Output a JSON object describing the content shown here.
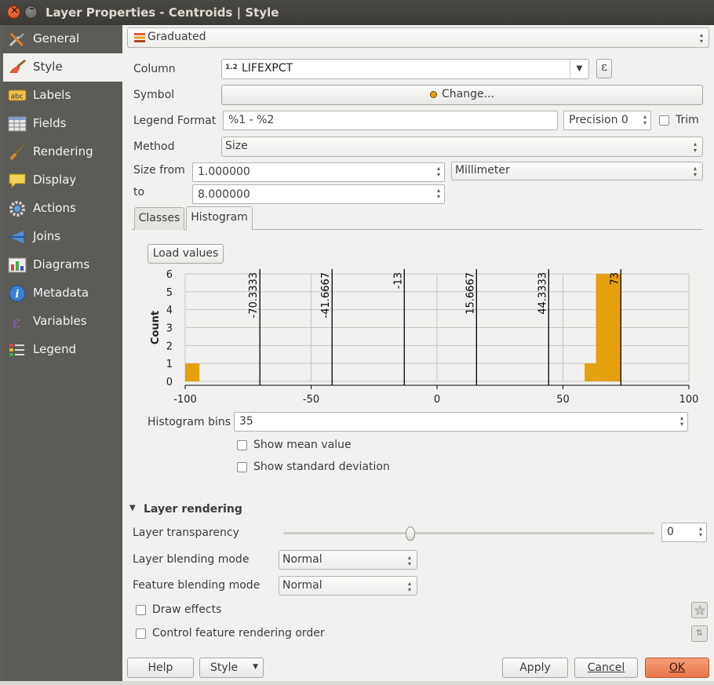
{
  "window": {
    "title": "Layer Properties - Centroids | Style"
  },
  "sidebar": {
    "items": [
      {
        "label": "General",
        "icon": "wrench-icon"
      },
      {
        "label": "Style",
        "icon": "paintbrush-icon"
      },
      {
        "label": "Labels",
        "icon": "abc-label-icon"
      },
      {
        "label": "Fields",
        "icon": "table-icon"
      },
      {
        "label": "Rendering",
        "icon": "brush-icon"
      },
      {
        "label": "Display",
        "icon": "speech-bubble-icon"
      },
      {
        "label": "Actions",
        "icon": "gear-icon"
      },
      {
        "label": "Joins",
        "icon": "join-icon"
      },
      {
        "label": "Diagrams",
        "icon": "diagram-icon"
      },
      {
        "label": "Metadata",
        "icon": "info-icon"
      },
      {
        "label": "Variables",
        "icon": "epsilon-icon"
      },
      {
        "label": "Legend",
        "icon": "legend-icon"
      }
    ],
    "active": "Style"
  },
  "renderer": {
    "value": "Graduated"
  },
  "column": {
    "label": "Column",
    "type_badge": "1.2",
    "value": "LIFEXPCT",
    "expr_button": "ε"
  },
  "symbol": {
    "label": "Symbol",
    "button": "Change..."
  },
  "legend_format": {
    "label": "Legend Format",
    "value": "%1 - %2",
    "precision": "Precision 0",
    "trim_label": "Trim"
  },
  "method": {
    "label": "Method",
    "value": "Size"
  },
  "size": {
    "from_label": "Size from",
    "from_value": "1.000000",
    "to_label": "to",
    "to_value": "8.000000",
    "unit": "Millimeter"
  },
  "tabs": {
    "classes": "Classes",
    "histogram": "Histogram",
    "active": "Histogram"
  },
  "load_values": "Load values",
  "chart_data": {
    "type": "bar",
    "ylabel": "Count",
    "xlim": [
      -100,
      100
    ],
    "ylim": [
      0,
      6
    ],
    "xticks": [
      "-100",
      "-50",
      "0",
      "50",
      "100"
    ],
    "yticks": [
      "0",
      "1",
      "2",
      "3",
      "4",
      "5",
      "6"
    ],
    "bar_color": "#e5a00d",
    "bars": [
      {
        "x0": -100,
        "x1": -94.3,
        "count": 1
      },
      {
        "x0": 58.6,
        "x1": 63.1,
        "count": 1
      },
      {
        "x0": 63.1,
        "x1": 73,
        "count": 6
      }
    ],
    "breaks": [
      {
        "value": -70.3333,
        "label": "-70.3333"
      },
      {
        "value": -41.6667,
        "label": "-41.6667"
      },
      {
        "value": -13,
        "label": "-13"
      },
      {
        "value": 15.6667,
        "label": "15.6667"
      },
      {
        "value": 44.3333,
        "label": "44.3333"
      },
      {
        "value": 73,
        "label": "73"
      }
    ]
  },
  "histogram_bins": {
    "label": "Histogram bins",
    "value": "35"
  },
  "show_mean": "Show mean value",
  "show_std": "Show standard deviation",
  "layer_rendering": {
    "title": "Layer rendering",
    "transparency_label": "Layer transparency",
    "transparency_value": "0",
    "transparency_level": 0,
    "layer_blend_label": "Layer blending mode",
    "layer_blend_value": "Normal",
    "feature_blend_label": "Feature blending mode",
    "feature_blend_value": "Normal",
    "draw_effects": "Draw effects",
    "control_order": "Control feature rendering order"
  },
  "footer": {
    "help": "Help",
    "style": "Style",
    "apply": "Apply",
    "cancel": "Cancel",
    "ok": "OK"
  },
  "colors": {
    "accent": "#f08a5d",
    "bar": "#e5a00d",
    "sidebar": "#5b5b57"
  }
}
